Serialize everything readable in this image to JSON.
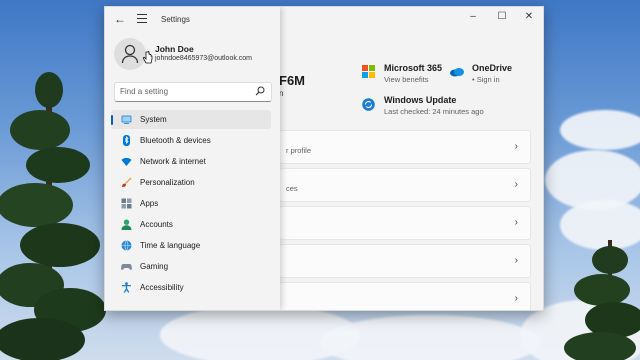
{
  "window": {
    "title": "Settings"
  },
  "user": {
    "name": "John Doe",
    "email": "johndoe8465973@outlook.com"
  },
  "search": {
    "placeholder": "Find a setting"
  },
  "nav": {
    "items": [
      {
        "label": "System",
        "icon": "system-icon",
        "active": true
      },
      {
        "label": "Bluetooth & devices",
        "icon": "bluetooth-icon"
      },
      {
        "label": "Network & internet",
        "icon": "wifi-icon"
      },
      {
        "label": "Personalization",
        "icon": "brush-icon"
      },
      {
        "label": "Apps",
        "icon": "apps-icon"
      },
      {
        "label": "Accounts",
        "icon": "accounts-icon"
      },
      {
        "label": "Time & language",
        "icon": "globe-icon"
      },
      {
        "label": "Gaming",
        "icon": "gamepad-icon"
      },
      {
        "label": "Accessibility",
        "icon": "accessibility-icon"
      }
    ]
  },
  "system": {
    "device_name_fragment": "F6M",
    "device_sub_fragment": "n",
    "microsoft365": {
      "title": "Microsoft 365",
      "subtitle": "View benefits"
    },
    "onedrive": {
      "title": "OneDrive",
      "subtitle": "• Sign in"
    },
    "windows_update": {
      "title": "Windows Update",
      "subtitle": "Last checked: 24 minutes ago"
    },
    "cards": [
      {
        "sub": "r profile"
      },
      {
        "sub": "ces"
      },
      {
        "sub": ""
      },
      {
        "sub": ""
      },
      {
        "sub": ""
      }
    ]
  },
  "colors": {
    "accent": "#005fb8",
    "window_bg": "#f3f3f3",
    "card_bg": "#fbfbfb"
  }
}
